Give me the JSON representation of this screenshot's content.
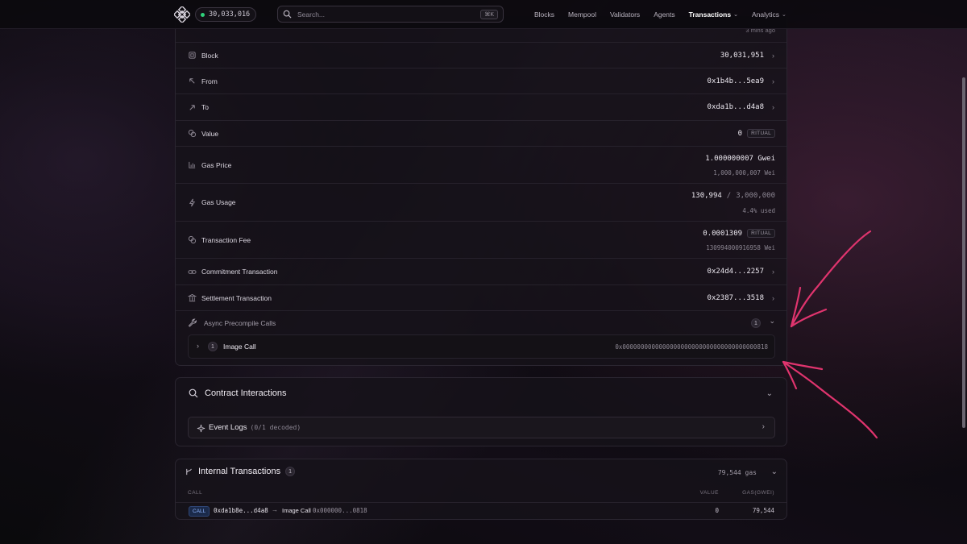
{
  "nav": {
    "block_number": "30,033,016",
    "search_placeholder": "Search...",
    "search_shortcut": "⌘K",
    "links": [
      {
        "label": "Blocks"
      },
      {
        "label": "Mempool"
      },
      {
        "label": "Validators"
      },
      {
        "label": "Agents"
      },
      {
        "label": "Transactions",
        "active": true,
        "dropdown": true
      },
      {
        "label": "Analytics",
        "dropdown": true
      }
    ]
  },
  "details": {
    "timestamp_ago": "3 mins ago",
    "block": {
      "label": "Block",
      "value": "30,031,951"
    },
    "from": {
      "label": "From",
      "value": "0x1b4b...5ea9"
    },
    "to": {
      "label": "To",
      "value": "0xda1b...d4a8"
    },
    "value": {
      "label": "Value",
      "value": "0",
      "unit": "RITUAL"
    },
    "gas_price": {
      "label": "Gas Price",
      "value": "1.000000007 Gwei",
      "sub": "1,000,000,007 Wei"
    },
    "gas_usage": {
      "label": "Gas Usage",
      "used": "130,994",
      "sep": "/",
      "limit": "3,000,000",
      "sub": "4.4% used"
    },
    "tx_fee": {
      "label": "Transaction Fee",
      "value": "0.0001309",
      "unit": "RITUAL",
      "sub": "130994000916958 Wei"
    },
    "commitment_tx": {
      "label": "Commitment Transaction",
      "value": "0x24d4...2257"
    },
    "settlement_tx": {
      "label": "Settlement Transaction",
      "value": "0x2387...3518"
    },
    "async": {
      "label": "Async Precompile Calls",
      "count": "1",
      "calls": [
        {
          "index": "1",
          "label": "Image Call",
          "address": "0x0000000000000000000000000000000000000818"
        }
      ]
    }
  },
  "contract_interactions": {
    "title": "Contract Interactions",
    "event_logs": {
      "label": "Event Logs",
      "sub": "(0/1 decoded)"
    }
  },
  "internal_transactions": {
    "title": "Internal Transactions",
    "count": "1",
    "total_gas": "79,544 gas",
    "columns": {
      "call": "CALL",
      "value": "VALUE",
      "gas": "GAS(GWEI)"
    },
    "rows": [
      {
        "type": "CALL",
        "from": "0xda1b8e...d4a8",
        "arrow": "→",
        "to_label": "Image Call",
        "to_addr": "0x000000...0818",
        "value": "0",
        "gas": "79,544"
      }
    ]
  },
  "colors": {
    "annotation": "#e0346e",
    "status_dot": "#2fd17a",
    "call_badge": "#8fb5ff"
  }
}
